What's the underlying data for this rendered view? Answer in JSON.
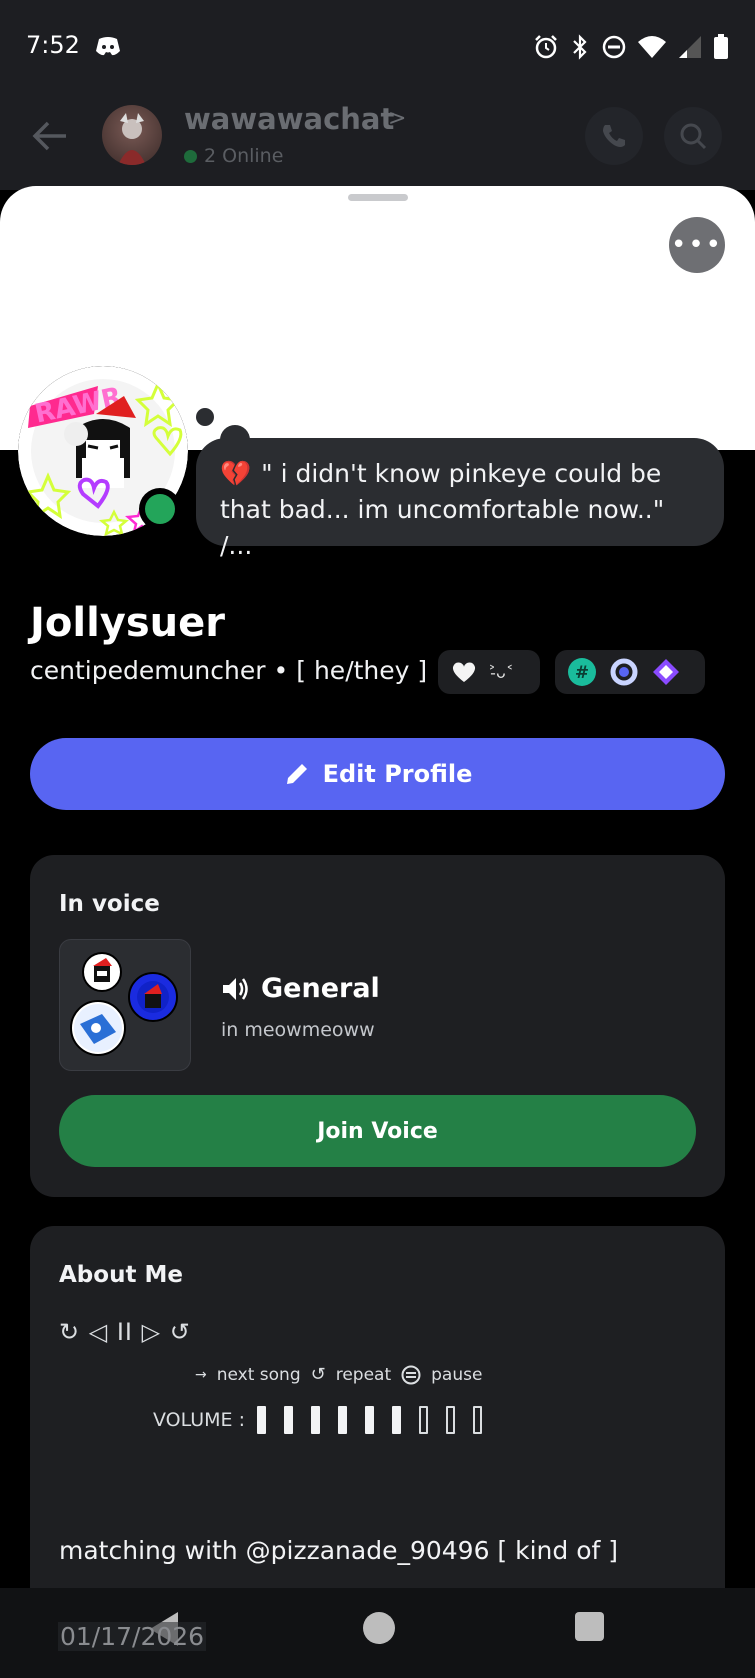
{
  "status_bar": {
    "time": "7:52",
    "icons": [
      "discord-icon",
      "alarm-icon",
      "bluetooth-icon",
      "dnd-icon",
      "wifi-icon",
      "signal-icon",
      "battery-icon"
    ]
  },
  "header": {
    "title": "wawawachat",
    "chevron": ">",
    "online": "2 Online"
  },
  "profile": {
    "bubble_emoji": "💔",
    "status_text": "\" i didn't know pinkeye could be that bad... im uncomfortable now..\" /...",
    "display_name": "Jollysuer",
    "username": "centipedemuncher",
    "separator": "•",
    "pronouns": "[ he/they ]",
    "tag_text": "˃̵ᴗ˂",
    "edit_label": "Edit Profile"
  },
  "voice_card": {
    "title": "In voice",
    "channel": "General",
    "server": "in meowmeoww",
    "join_label": "Join Voice"
  },
  "about_card": {
    "title": "About Me",
    "player_controls": "↻  ◁ II ▷  ↺",
    "legend_next": "next song",
    "legend_repeat": "repeat",
    "legend_pause": "pause",
    "volume_label": "VOLUME :",
    "volume_level": 0.67,
    "matching_text": "matching with @pizzanade_90496 [ kind of ]"
  },
  "overlay_date": "01/17/2026",
  "colors": {
    "blurple": "#5865f2",
    "green": "#248046",
    "online": "#23a55a",
    "card": "#1e1f22"
  }
}
